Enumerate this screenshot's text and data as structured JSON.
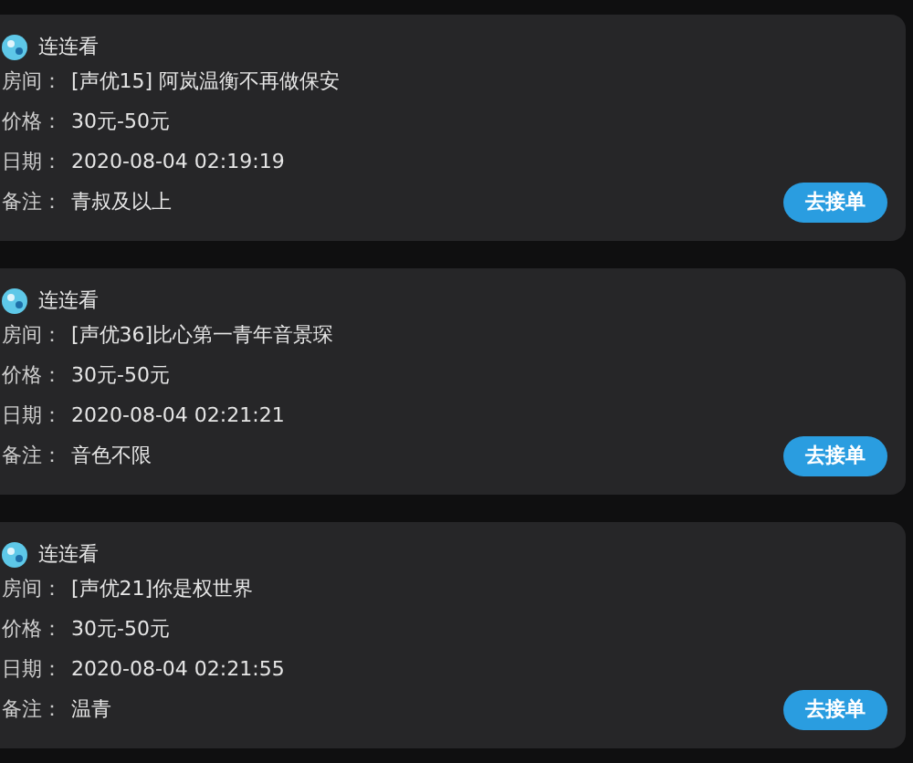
{
  "orders": [
    {
      "app_name": "连连看",
      "fields": [
        {
          "label": "房间：",
          "value": "[声优15] 阿岚温衡不再做保安"
        },
        {
          "label": "价格：",
          "value": "30元-50元"
        },
        {
          "label": "日期：",
          "value": "2020-08-04 02:19:19"
        },
        {
          "label": "备注：",
          "value": "青叔及以上"
        }
      ],
      "button": "去接单"
    },
    {
      "app_name": "连连看",
      "fields": [
        {
          "label": "房间：",
          "value": "[声优36]比心第一青年音景琛"
        },
        {
          "label": "价格：",
          "value": "30元-50元"
        },
        {
          "label": "日期：",
          "value": "2020-08-04 02:21:21"
        },
        {
          "label": "备注：",
          "value": "音色不限"
        }
      ],
      "button": "去接单"
    },
    {
      "app_name": "连连看",
      "fields": [
        {
          "label": "房间：",
          "value": "[声优21]你是权世界"
        },
        {
          "label": "价格：",
          "value": "30元-50元"
        },
        {
          "label": "日期：",
          "value": "2020-08-04 02:21:55"
        },
        {
          "label": "备注：",
          "value": "温青"
        }
      ],
      "button": "去接单"
    }
  ]
}
